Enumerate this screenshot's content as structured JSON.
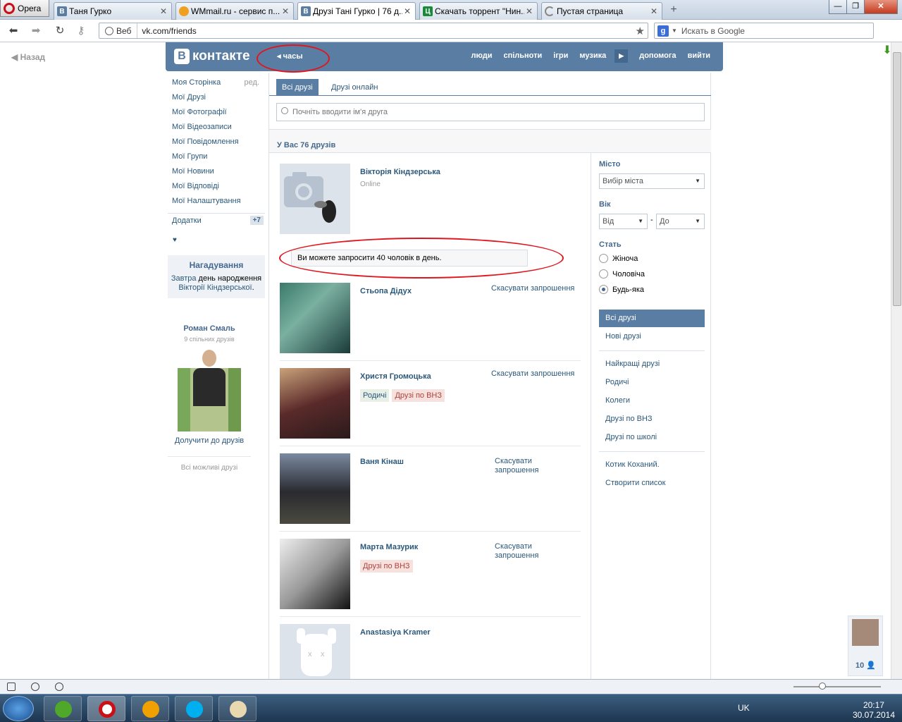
{
  "browser": {
    "opera_label": "Opera",
    "tabs": [
      {
        "title": "Таня Гурко",
        "icon": "vk-icon"
      },
      {
        "title": "WMmail.ru - сервис п...",
        "icon": "wmmail-icon"
      },
      {
        "title": "Друзі Тані Гурко | 76 д...",
        "icon": "vk-icon",
        "active": true
      },
      {
        "title": "Скачать торрент \"Нин...",
        "icon": "torrent-icon"
      },
      {
        "title": "Пустая страница",
        "icon": "loading-icon"
      }
    ],
    "address_prefix": "Веб",
    "url": "vk.com/friends",
    "search_placeholder": "Искать в Google"
  },
  "page": {
    "back_label": "Назад",
    "logo_text": "контакте",
    "clock_label": "часы",
    "nav": [
      "люди",
      "спільноти",
      "ігри",
      "музика",
      "допомога",
      "вийти"
    ]
  },
  "left_menu": {
    "items": [
      "Моя Сторінка",
      "Мої Друзі",
      "Мої Фотографії",
      "Мої Відеозаписи",
      "Мої Повідомлення",
      "Мої Групи",
      "Мої Новини",
      "Мої Відповіді",
      "Мої Налаштування"
    ],
    "edit_label": "ред.",
    "addons_label": "Додатки",
    "addons_badge": "+7",
    "heart": "♥",
    "reminder": {
      "title": "Нагадування",
      "text_1": "Завтра",
      "text_2": "день народження",
      "link": "Вікторії Кіндзерської",
      "end": "."
    },
    "suggestion": {
      "name": "Роман Смаль",
      "common": "9 спільних друзів",
      "join": "Долучити до друзів",
      "all": "Всі можливі друзі"
    }
  },
  "content": {
    "tab_all": "Всі друзі",
    "tab_online": "Друзі онлайн",
    "search_placeholder": "Почніть вводити ім'я друга",
    "summary": "У Вас 76 друзів",
    "notice": "Ви можете запросити 40 чоловік в день.",
    "friends": [
      {
        "name": "Вікторія Кіндзерська",
        "status": "Online"
      },
      {
        "name": "Стьопа Дідух",
        "action": "Скасувати запрошення"
      },
      {
        "name": "Христя Громоцька",
        "action": "Скасувати запрошення",
        "tags": [
          "Родичі",
          "Друзі по ВНЗ"
        ]
      },
      {
        "name": "Ваня Кінаш",
        "action": "Скасувати запрошення"
      },
      {
        "name": "Марта Мазурик",
        "action": "Скасувати запрошення",
        "tags": [
          "Друзі по ВНЗ"
        ]
      },
      {
        "name": "Anastasiya Kramer"
      }
    ]
  },
  "filter": {
    "city_label": "Місто",
    "city_value": "Вибір міста",
    "age_label": "Вік",
    "age_from": "Від",
    "age_dash": "-",
    "age_to": "До",
    "sex_label": "Стать",
    "sex_options": [
      "Жіноча",
      "Чоловіча",
      "Будь-яка"
    ],
    "sex_selected": "Будь-яка",
    "lists": [
      "Всі друзі",
      "Нові друзі",
      "Найкращі друзі",
      "Родичі",
      "Колеги",
      "Друзі по ВНЗ",
      "Друзі по школі",
      "Котик Коханий.",
      "Створити список"
    ],
    "selected": "Всі друзі"
  },
  "chat_count": "10",
  "system": {
    "lang": "UK",
    "time": "20:17",
    "date": "30.07.2014"
  },
  "colors": {
    "vk_blue": "#597da3",
    "link": "#2b587a",
    "annotation_red": "#e0161e"
  }
}
